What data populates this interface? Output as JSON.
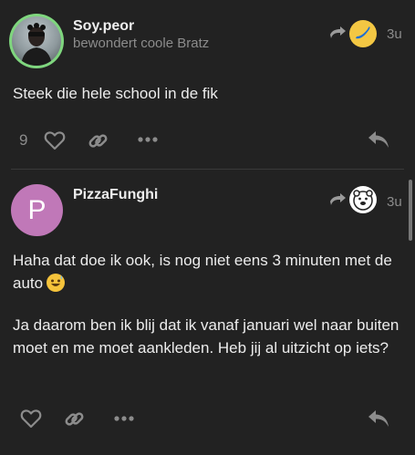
{
  "posts": [
    {
      "username": "Soy.peor",
      "user_title": "bewondert coole Bratz",
      "time": "3u",
      "body": "Steek die hele school in de fik",
      "like_count": "9",
      "avatar_ring_color": "#7fd67e",
      "reply_to_avatar": "banana-emoji-avatar"
    },
    {
      "username": "PizzaFunghi",
      "avatar_letter": "P",
      "avatar_color": "#c078b8",
      "time": "3u",
      "body_p1": "Haha dat doe ik ook, is nog niet eens 3 minuten met de auto",
      "body_p2": "Ja daarom ben ik blij dat ik vanaf januari wel naar buiten moet en me moet aankleden. Heb jij al uitzicht op iets?",
      "reply_to_avatar": "polar-bear-avatar"
    }
  ],
  "theme": {
    "background": "#222222",
    "text": "#ececec",
    "muted": "#8c8c8c"
  }
}
